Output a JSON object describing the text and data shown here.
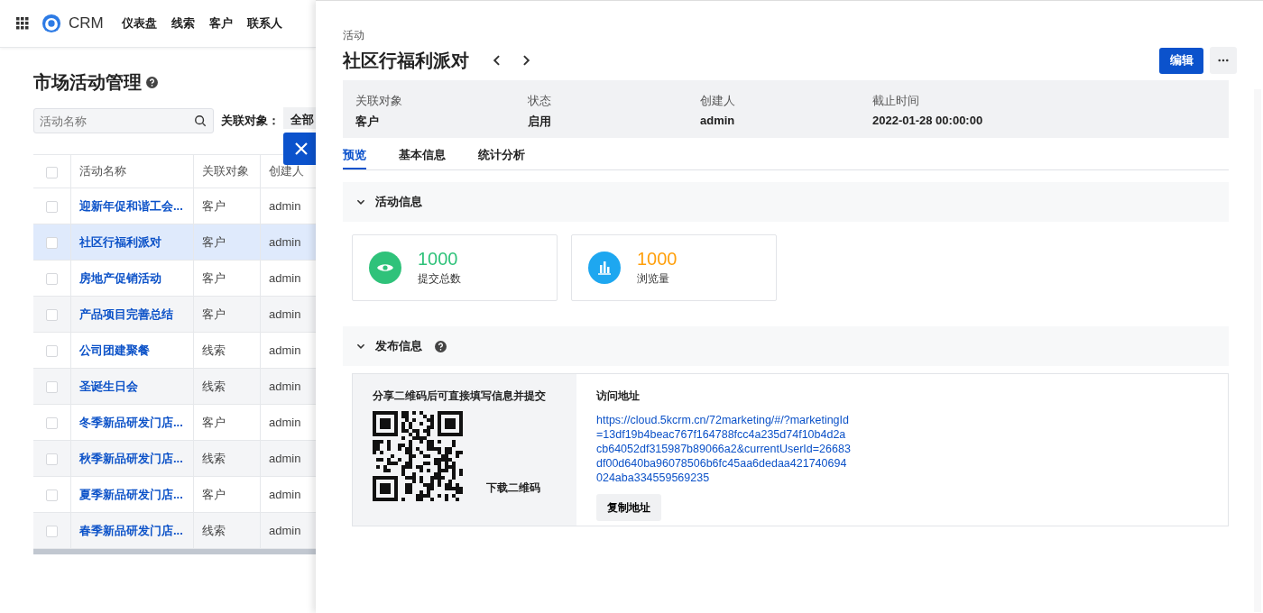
{
  "nav": {
    "brand": "CRM",
    "items": [
      "仪表盘",
      "线索",
      "客户",
      "联系人"
    ]
  },
  "page": {
    "title": "市场活动管理",
    "search": {
      "placeholder": "活动名称"
    },
    "filter": {
      "label": "关联对象：",
      "value": "全部"
    },
    "table": {
      "all_checked": false,
      "columns": [
        "活动名称",
        "关联对象",
        "创建人"
      ],
      "rows": [
        {
          "name": "迎新年促和谐工会...",
          "target": "客户",
          "creator": "admin",
          "selected": false,
          "checked": false
        },
        {
          "name": "社区行福利派对",
          "target": "客户",
          "creator": "admin",
          "selected": true,
          "checked": false
        },
        {
          "name": "房地产促销活动",
          "target": "客户",
          "creator": "admin",
          "selected": false,
          "checked": false
        },
        {
          "name": "产品项目完善总结",
          "target": "客户",
          "creator": "admin",
          "selected": false,
          "checked": false
        },
        {
          "name": "公司团建聚餐",
          "target": "线索",
          "creator": "admin",
          "selected": false,
          "checked": false
        },
        {
          "name": "圣诞生日会",
          "target": "线索",
          "creator": "admin",
          "selected": false,
          "checked": false
        },
        {
          "name": "冬季新品研发门店...",
          "target": "客户",
          "creator": "admin",
          "selected": false,
          "checked": false
        },
        {
          "name": "秋季新品研发门店...",
          "target": "线索",
          "creator": "admin",
          "selected": false,
          "checked": false
        },
        {
          "name": "夏季新品研发门店...",
          "target": "客户",
          "creator": "admin",
          "selected": false,
          "checked": false
        },
        {
          "name": "春季新品研发门店...",
          "target": "线索",
          "creator": "admin",
          "selected": false,
          "checked": false
        }
      ]
    }
  },
  "drawer": {
    "type": "活动",
    "title": "社区行福利派对",
    "edit_button": "编辑",
    "summary": [
      {
        "label": "关联对象",
        "value": "客户"
      },
      {
        "label": "状态",
        "value": "启用"
      },
      {
        "label": "创建人",
        "value": "admin"
      },
      {
        "label": "截止时间",
        "value": "2022-01-28 00:00:00"
      }
    ],
    "tabs": [
      {
        "label": "预览",
        "selected": true
      },
      {
        "label": "基本信息",
        "selected": false
      },
      {
        "label": "统计分析",
        "selected": false
      }
    ],
    "activity_section": {
      "title": "活动信息",
      "expanded": true,
      "stats": [
        {
          "kind": "eye",
          "value": "1000",
          "label": "提交总数",
          "color": "#2fc27a"
        },
        {
          "kind": "chart",
          "value": "1000",
          "label": "浏览量",
          "color": "#ff9f0a"
        }
      ]
    },
    "publish_section": {
      "title": "发布信息",
      "expanded": true,
      "share_hint": "分享二维码后可直接填写信息并提交",
      "download": "下载二维码",
      "address_label": "访问地址",
      "url": "https://cloud.5kcrm.cn/72marketing/#/?marketingId=13df19b4beac767f164788fcc4a235d74f10b4d2acb64052df315987b89066a2&currentUserId=26683df00d640ba96078506b6fc45aa6dedaa421740694024aba334559569235",
      "copy_button": "复制地址"
    }
  }
}
